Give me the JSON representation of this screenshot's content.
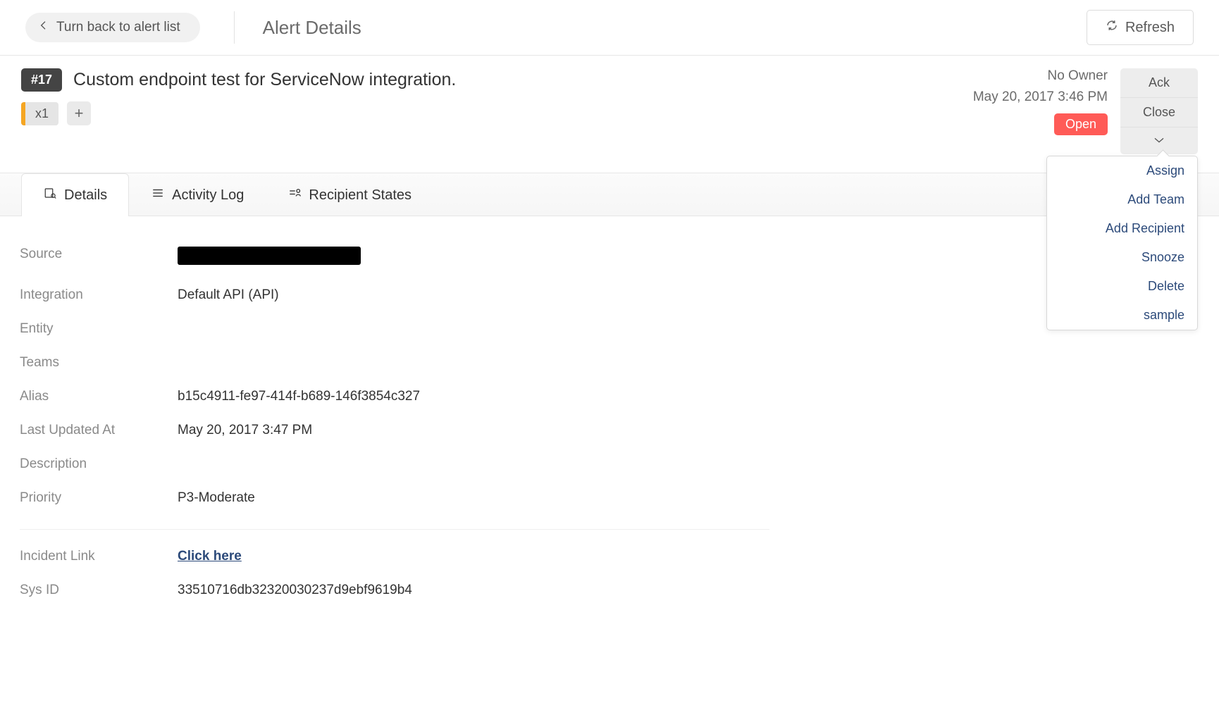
{
  "header": {
    "back_label": "Turn back to alert list",
    "page_title": "Alert Details",
    "refresh_label": "Refresh"
  },
  "alert": {
    "id_label": "#17",
    "title": "Custom endpoint test for ServiceNow integration.",
    "count_label": "x1",
    "owner": "No Owner",
    "created_at": "May 20, 2017 3:46 PM",
    "status": "Open"
  },
  "actions": {
    "ack": "Ack",
    "close": "Close"
  },
  "dropdown": {
    "assign": "Assign",
    "add_team": "Add Team",
    "add_recipient": "Add Recipient",
    "snooze": "Snooze",
    "delete": "Delete",
    "sample": "sample"
  },
  "tabs": {
    "details": "Details",
    "activity_log": "Activity Log",
    "recipient_states": "Recipient States"
  },
  "details": {
    "labels": {
      "source": "Source",
      "integration": "Integration",
      "entity": "Entity",
      "teams": "Teams",
      "alias": "Alias",
      "last_updated_at": "Last Updated At",
      "description": "Description",
      "priority": "Priority",
      "incident_link": "Incident Link",
      "sys_id": "Sys ID"
    },
    "values": {
      "integration": "Default API (API)",
      "entity": "",
      "teams": "",
      "alias": "b15c4911-fe97-414f-b689-146f3854c327",
      "last_updated_at": "May 20, 2017 3:47 PM",
      "description": "",
      "priority": "P3-Moderate",
      "incident_link": "Click here",
      "sys_id": "33510716db32320030237d9ebf9619b4"
    }
  }
}
